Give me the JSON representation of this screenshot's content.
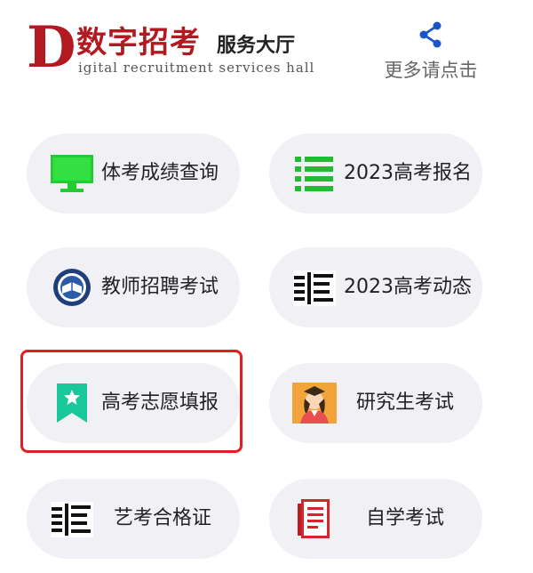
{
  "header": {
    "logo_letter": "D",
    "logo_title": "数字招考",
    "logo_subtitle": "服务大厅",
    "logo_english": "igital recruitment services hall",
    "share_label": "更多请点击"
  },
  "tiles": [
    {
      "label": "体考成绩查询",
      "icon": "monitor-icon"
    },
    {
      "label": "2023高考报名",
      "icon": "list-icon"
    },
    {
      "label": "教师招聘考试",
      "icon": "emblem-icon"
    },
    {
      "label": "2023高考动态",
      "icon": "news-icon"
    },
    {
      "label": "高考志愿填报",
      "icon": "bookmark-star-icon"
    },
    {
      "label": "研究生考试",
      "icon": "graduate-avatar-icon"
    },
    {
      "label": "艺考合格证",
      "icon": "news-icon"
    },
    {
      "label": "自学考试",
      "icon": "document-icon"
    }
  ],
  "colors": {
    "brand_red": "#b01a20",
    "share_blue": "#1a56c8",
    "pill_bg": "#f1f1f5",
    "monitor_green": "#22cc33",
    "list_green": "#22bb33",
    "bookmark_teal": "#18c79a",
    "highlight_red": "#e02020"
  }
}
